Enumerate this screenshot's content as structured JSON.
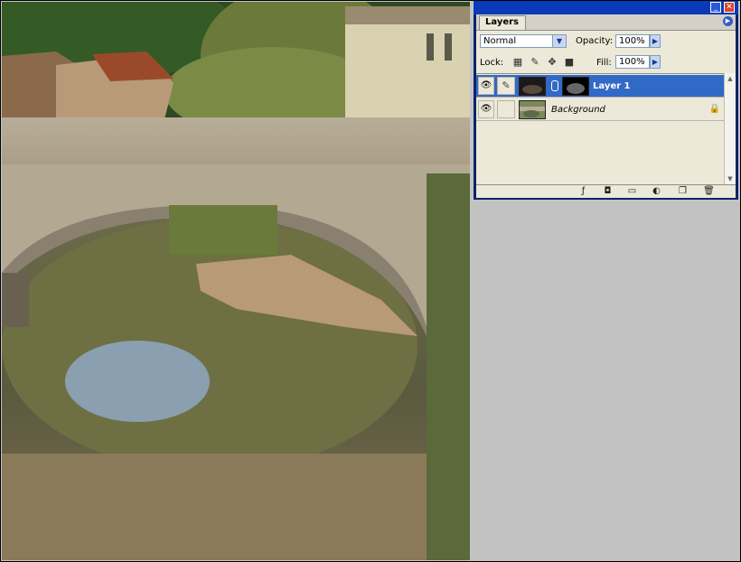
{
  "palette": {
    "title_buttons": {
      "minimize": "_",
      "close": "✕"
    },
    "tab_label": "Layers",
    "menu_icon": "flyout-menu-icon",
    "blend_mode": "Normal",
    "opacity_label": "Opacity:",
    "opacity_value": "100%",
    "lock_label": "Lock:",
    "lock_icons": [
      "lock-transparent-icon",
      "lock-brush-icon",
      "lock-move-icon",
      "lock-all-icon"
    ],
    "fill_label": "Fill:",
    "fill_value": "100%",
    "layers": [
      {
        "name": "Layer 1",
        "selected": true,
        "visible": true,
        "has_mask": true
      },
      {
        "name": "Background",
        "selected": false,
        "visible": true,
        "locked": true
      }
    ],
    "footer_icons": [
      "layer-style-icon",
      "add-mask-icon",
      "new-group-icon",
      "adjustment-layer-icon",
      "new-layer-icon",
      "trash-icon"
    ],
    "colors": {
      "selection": "#3169c6",
      "titlebar": "#0a3ab8",
      "panel": "#ece9d8"
    }
  }
}
